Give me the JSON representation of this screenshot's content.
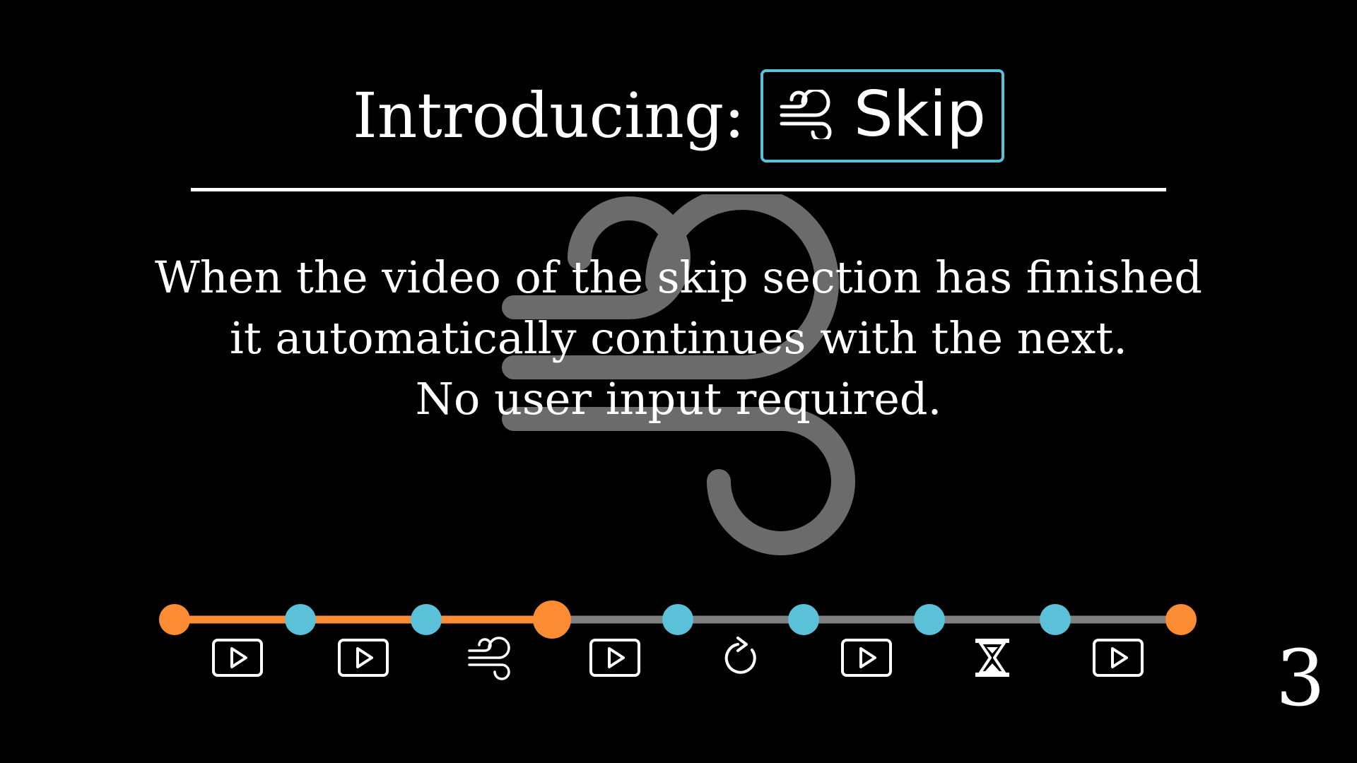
{
  "slide": {
    "title": "Introducing:",
    "badge_label": "Skip",
    "badge_icon": "wind-icon",
    "description_lines": [
      "When the video of the skip section has finished",
      "it automatically continues with the next.",
      "No user input required."
    ],
    "page_number": "3"
  },
  "timeline": {
    "current_node_index": 3,
    "nodes": [
      {
        "color": "orange",
        "kind": "endpoint"
      },
      {
        "color": "blue",
        "kind": "marker"
      },
      {
        "color": "blue",
        "kind": "marker"
      },
      {
        "color": "orange",
        "kind": "current"
      },
      {
        "color": "blue",
        "kind": "marker"
      },
      {
        "color": "blue",
        "kind": "marker"
      },
      {
        "color": "blue",
        "kind": "marker"
      },
      {
        "color": "blue",
        "kind": "marker"
      },
      {
        "color": "orange",
        "kind": "endpoint"
      }
    ],
    "segments": [
      {
        "icon": "play-icon",
        "state": "done"
      },
      {
        "icon": "play-icon",
        "state": "done"
      },
      {
        "icon": "wind-icon",
        "state": "done"
      },
      {
        "icon": "play-icon",
        "state": "pending"
      },
      {
        "icon": "replay-icon",
        "state": "pending"
      },
      {
        "icon": "play-icon",
        "state": "pending"
      },
      {
        "icon": "hourglass-icon",
        "state": "pending"
      },
      {
        "icon": "play-icon",
        "state": "pending"
      }
    ]
  },
  "colors": {
    "accent_orange": "#fb8c33",
    "accent_blue": "#5ac1d9",
    "track_gray": "#808080",
    "background": "#000000",
    "foreground": "#ffffff",
    "watermark_gray": "#6b6b6b"
  }
}
